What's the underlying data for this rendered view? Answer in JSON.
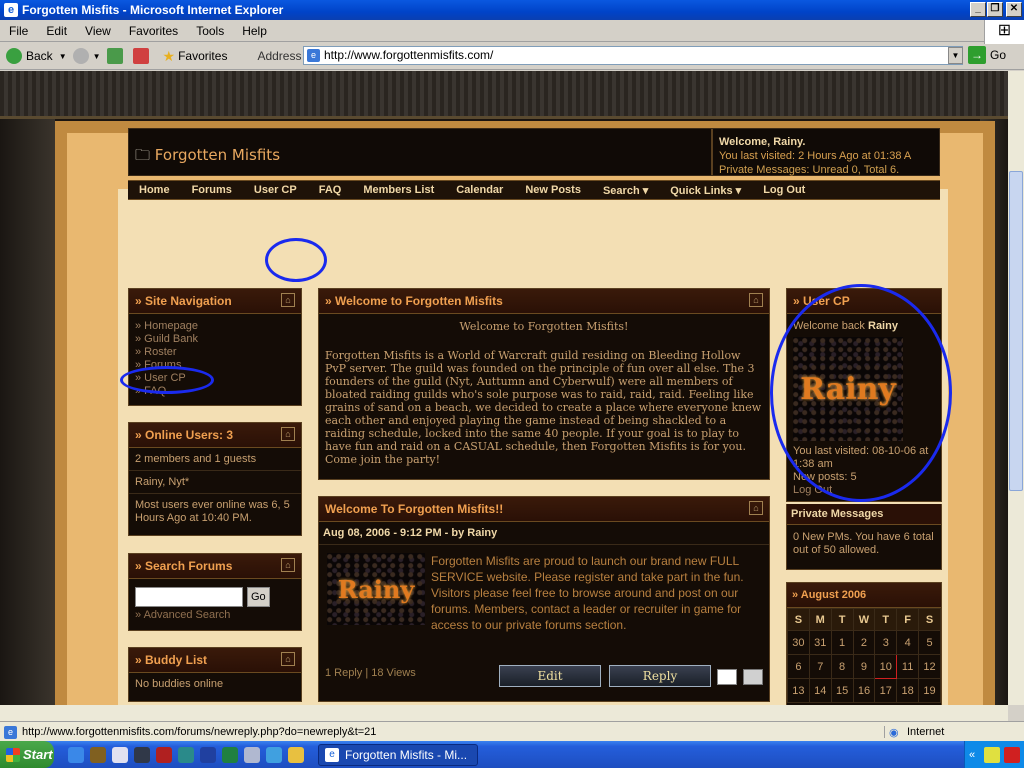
{
  "window": {
    "title": "Forgotten Misfits - Microsoft Internet Explorer",
    "controls": [
      "_",
      "❐",
      "✕"
    ]
  },
  "menu": [
    "File",
    "Edit",
    "View",
    "Favorites",
    "Tools",
    "Help"
  ],
  "toolbar": {
    "back": "Back",
    "favorites": "Favorites",
    "address_label": "Address",
    "address_value": "http://www.forgottenmisfits.com/",
    "go": "Go"
  },
  "site": {
    "logo": "Forgotten Misfits",
    "welcome_title": "Welcome, Rainy.",
    "last_visited": "You last visited: 2 Hours Ago at 01:38 A",
    "private_messages": "Private Messages: Unread 0, Total 6.",
    "nav": [
      "Home",
      "Forums",
      "User CP",
      "FAQ",
      "Members List",
      "Calendar",
      "New Posts",
      "Search ▾",
      "Quick Links ▾",
      "Log Out"
    ]
  },
  "site_navigation": {
    "title": "» Site Navigation",
    "links": [
      "» Homepage",
      "» Guild Bank",
      "» Roster",
      "» Forums",
      "» User CP",
      "» FAQ"
    ]
  },
  "online_users": {
    "title": "» Online Users: 3",
    "summary": "2 members and 1 guests",
    "names": "Rainy, Nyt*",
    "record": "Most users ever online was 6, 5 Hours Ago at 10:40 PM."
  },
  "search": {
    "title": "» Search Forums",
    "button": "Go",
    "advanced": "» Advanced Search"
  },
  "buddy": {
    "title": "» Buddy List",
    "empty": "No buddies online"
  },
  "welcome_panel": {
    "title": "» Welcome to Forgotten Misfits",
    "heading": "Welcome to Forgotten Misfits!",
    "body": "Forgotten Misfits is a World of Warcraft guild residing on Bleeding Hollow PvP server. The guild was founded on the principle of fun over all else. The 3 founders of the guild (Nyt, Auttumn and Cyberwulf) were all members of bloated raiding guilds who's sole purpose was to raid, raid, raid. Feeling like grains of sand on a beach, we decided to create a place where everyone knew each other and enjoyed playing the game instead of being shackled to a raiding schedule, locked into the same 40 people. If your goal is to play to have fun and raid on a CASUAL schedule, then Forgotten Misfits is for you. Come join the party!"
  },
  "news": {
    "title": "Welcome To Forgotten Misfits!!",
    "meta": "Aug 08, 2006 - 9:12 PM - by Rainy",
    "avatar_text": "Rainy",
    "body": "Forgotten Misfits are proud to launch our brand new FULL SERVICE website. Please register and take part in the fun. Visitors please feel free to browse around and post on our forums. Members, contact a leader or recruiter in game for access to our private forums section.",
    "stats": "1 Reply | 18 Views",
    "edit": "Edit",
    "reply": "Reply"
  },
  "user_cp": {
    "title": "» User CP",
    "welcome_back": "Welcome back",
    "username": "Rainy",
    "avatar_text": "Rainy",
    "last_visited": "You last visited: 08-10-06 at 1:38 am",
    "new_posts": "New posts: 5",
    "logout": "Log Out"
  },
  "pm_panel": {
    "title": "Private Messages",
    "body": "0 New PMs. You have 6 total out of 50 allowed."
  },
  "calendar": {
    "title": "» August 2006",
    "dow": [
      "S",
      "M",
      "T",
      "W",
      "T",
      "F",
      "S"
    ],
    "weeks": [
      [
        "30",
        "31",
        "1",
        "2",
        "3",
        "4",
        "5"
      ],
      [
        "6",
        "7",
        "8",
        "9",
        "10",
        "11",
        "12"
      ],
      [
        "13",
        "14",
        "15",
        "16",
        "17",
        "18",
        "19"
      ]
    ],
    "today": "10"
  },
  "statusbar": {
    "url": "http://www.forgottenmisfits.com/forums/newreply.php?do=newreply&t=21",
    "zone": "Internet"
  },
  "taskbar": {
    "start": "Start",
    "task": "Forgotten Misfits - Mi...",
    "tray_chevron": "«"
  }
}
